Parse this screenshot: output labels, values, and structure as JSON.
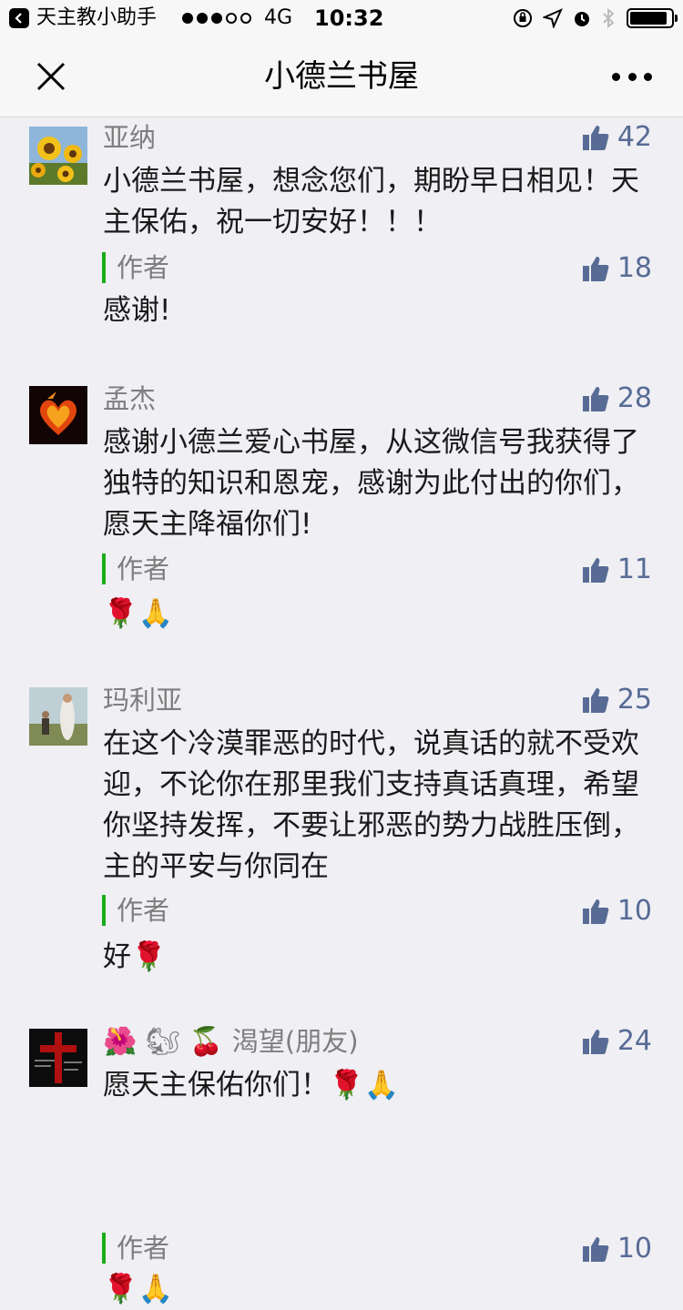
{
  "status_bar": {
    "app_name": "天主教小助手",
    "network": "4G",
    "time": "10:32"
  },
  "nav": {
    "title": "小德兰书屋",
    "close_icon": "close-icon",
    "more_icon": "more-icon"
  },
  "comments": [
    {
      "name": "亚纳",
      "likes": "42",
      "text": "小德兰书屋，想念您们，期盼早日相见！天主保佑，祝一切安好！！！",
      "author_label": "作者",
      "author_likes": "18",
      "reply": "感谢!"
    },
    {
      "name": "孟杰",
      "likes": "28",
      "text": "感谢小德兰爱心书屋，从这微信号我获得了独特的知识和恩宠，感谢为此付出的你们，愿天主降福你们!",
      "author_label": "作者",
      "author_likes": "11",
      "reply": "🌹🙏"
    },
    {
      "name": "玛利亚",
      "likes": "25",
      "text": "在这个冷漠罪恶的时代，说真话的就不受欢迎，不论你在那里我们支持真话真理，希望你坚持发挥，不要让邪恶的势力战胜压倒，主的平安与你同在",
      "author_label": "作者",
      "author_likes": "10",
      "reply": "好🌹"
    },
    {
      "name_emojis": "🌺 🐿 🍒",
      "name": "渴望(朋友)",
      "likes": "24",
      "text": "愿天主保佑你们！🌹🙏",
      "author_label": "作者",
      "author_likes": "10",
      "reply": "🌹🙏"
    }
  ],
  "colors": {
    "accent_link": "#576b95",
    "author_bar": "#1aad19",
    "background": "#efeff4"
  }
}
